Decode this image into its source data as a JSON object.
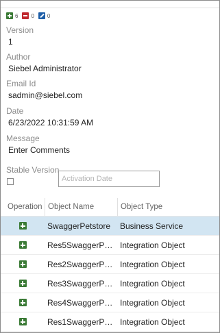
{
  "summary": {
    "added_count": "6",
    "deleted_count": "0",
    "modified_count": "0"
  },
  "details": {
    "version_label": "Version",
    "version_value": "1",
    "author_label": "Author",
    "author_value": "Siebel Administrator",
    "email_label": "Email Id",
    "email_value": "sadmin@siebel.com",
    "date_label": "Date",
    "date_value": "6/23/2022 10:31:59 AM",
    "message_label": "Message",
    "message_value": "Enter Comments",
    "stable_version_label": "Stable Version",
    "activation_date_placeholder": "Activation Date"
  },
  "table": {
    "headers": [
      "Operation",
      "Object Name",
      "Object Type"
    ],
    "rows": [
      {
        "name": "SwaggerPetstore",
        "type": "Business Service",
        "selected": true
      },
      {
        "name": "Res5SwaggerPetst...",
        "type": "Integration Object"
      },
      {
        "name": "Res2SwaggerPetst...",
        "type": "Integration Object"
      },
      {
        "name": "Res3SwaggerPetst...",
        "type": "Integration Object"
      },
      {
        "name": "Res4SwaggerPetst...",
        "type": "Integration Object"
      },
      {
        "name": "Res1SwaggerPetst...",
        "type": "Integration Object"
      }
    ]
  },
  "colors": {
    "added": "#3a7a35",
    "deleted": "#c0272d",
    "modified": "#1f5fa8",
    "selected_row": "#d2e5f2"
  }
}
